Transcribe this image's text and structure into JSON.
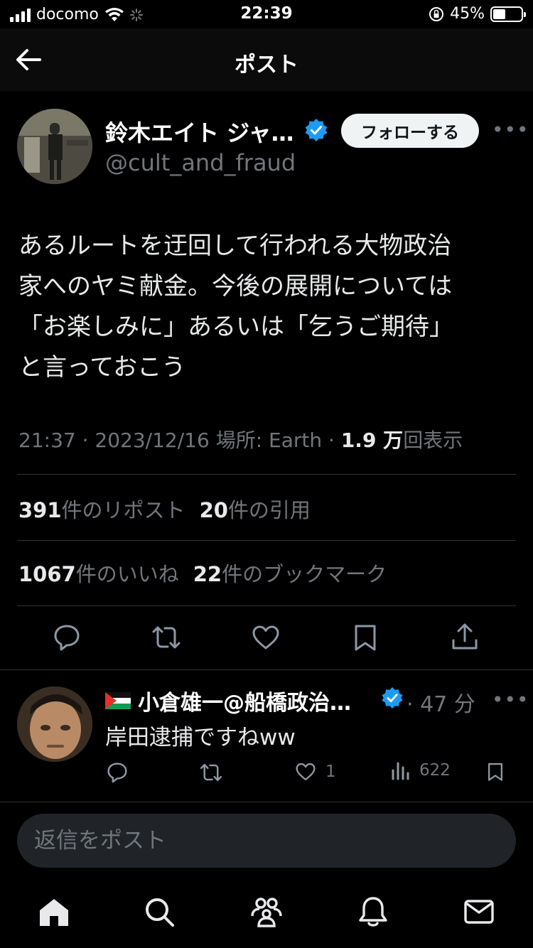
{
  "status_bar": {
    "carrier": "docomo",
    "time": "22:39",
    "battery_percent": "45%",
    "battery_level": 0.45
  },
  "header": {
    "title": "ポスト",
    "back_icon": "arrow-left-icon"
  },
  "post": {
    "author": {
      "name": "鈴木エイト ジャ…",
      "handle": "@cult_and_fraud",
      "verified": true
    },
    "follow_label": "フォローする",
    "text_lines": [
      "あるルートを迂回して行われる大物政治",
      "家へのヤミ献金。今後の展開については",
      "「お楽しみに」あるいは「乞うご期待」",
      "と言っておこう"
    ],
    "meta": {
      "time": "21:37",
      "separator": " · ",
      "date": "2023/12/16",
      "location": "場所: Earth",
      "views": "1.9 万",
      "views_label": "回表示"
    },
    "stats": {
      "reposts": "391",
      "reposts_label": "件のリポスト",
      "quotes": "20",
      "quotes_label": "件の引用",
      "likes": "1067",
      "likes_label": "件のいいね",
      "bookmarks": "22",
      "bookmarks_label": "件のブックマーク"
    },
    "actions": [
      "reply-icon",
      "repost-icon",
      "like-icon",
      "bookmark-icon",
      "share-icon"
    ]
  },
  "reply": {
    "name": "小倉雄一@船橋政治…",
    "verified": true,
    "time": "· 47 分",
    "text": "岸田逮捕ですねww",
    "likes": "1",
    "views": "622"
  },
  "composer": {
    "placeholder": "返信をポスト"
  },
  "tab_bar": [
    "home-icon",
    "search-icon",
    "communities-icon",
    "notifications-icon",
    "messages-icon"
  ],
  "colors": {
    "accent": "#1d9bf0",
    "secondary_text": "#71767b",
    "divider": "#2f3336",
    "follow_button_bg": "#eff3f4"
  }
}
